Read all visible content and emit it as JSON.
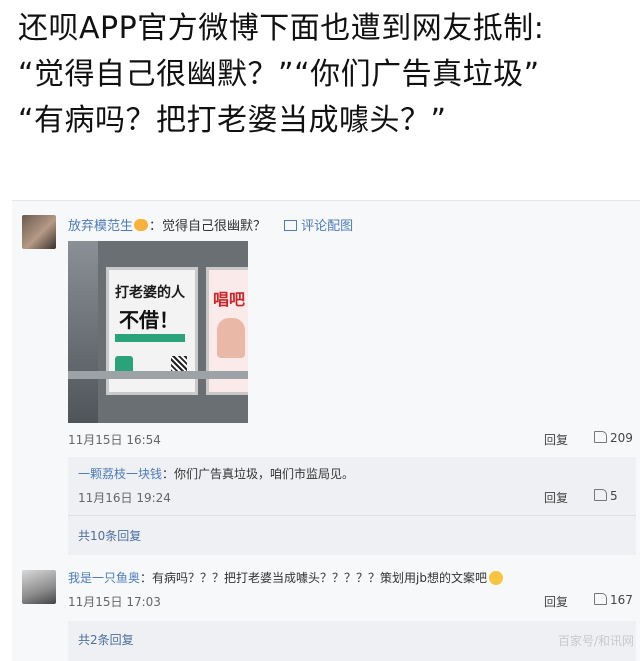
{
  "headline": {
    "line1": "还呗APP官方微博下面也遭到网友抵制:",
    "line2": "“觉得自己很幽默？”“你们广告真垃圾”",
    "line3": "“有病吗？把打老婆当成噱头？”"
  },
  "comment1": {
    "username": "放弃模范生",
    "text": "：觉得自己很幽默？",
    "pic_link": "评论配图",
    "photo": {
      "poster_title": "打老婆的人",
      "poster_big": "不借！",
      "side_poster": "唱吧"
    },
    "time": "11月15日 16:54",
    "reply": "回复",
    "likes": "209"
  },
  "reply1": {
    "username": "一颗荔枝一块钱",
    "text": "：你们广告真垃圾，咱们市监局见。",
    "time": "11月16日 19:24",
    "reply": "回复",
    "likes": "5",
    "more": "共10条回复"
  },
  "comment2": {
    "username": "我是一只鱼奥",
    "text": "：有病吗？？？把打老婆当成噱头？？？？？策划用jb想的文案吧",
    "time": "11月15日 17:03",
    "reply": "回复",
    "likes": "167",
    "more": "共2条回复"
  },
  "watermark": "百家号/和讯网"
}
